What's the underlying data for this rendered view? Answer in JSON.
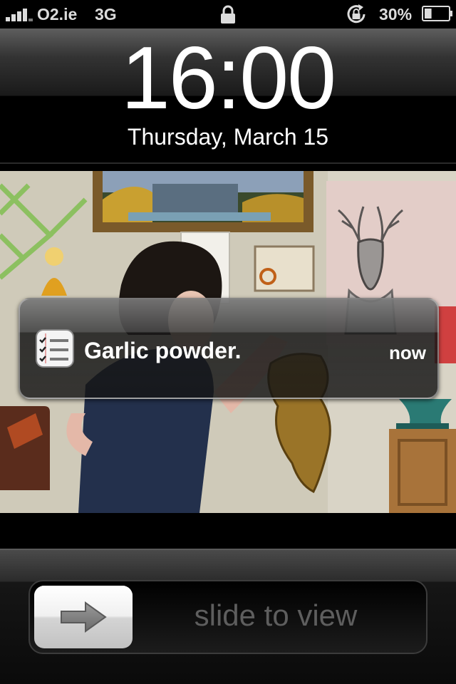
{
  "status_bar": {
    "carrier": "O2.ie",
    "network": "3G",
    "battery_percent": "30%",
    "battery_level": 0.3,
    "signal_bars": 4,
    "icons": [
      "signal-bars-icon",
      "lock-icon",
      "rotation-lock-icon",
      "battery-icon"
    ]
  },
  "lock_screen": {
    "time": "16:00",
    "date": "Thursday, March 15"
  },
  "notification": {
    "app_icon": "reminders-icon",
    "message": "Garlic powder.",
    "time": "now"
  },
  "slider": {
    "label": "slide to view",
    "icon": "arrow-right-icon"
  },
  "colors": {
    "status_text": "#dcdcdc",
    "slider_text": "#5e5e5e",
    "frame_accent": "#4a3a1c"
  }
}
